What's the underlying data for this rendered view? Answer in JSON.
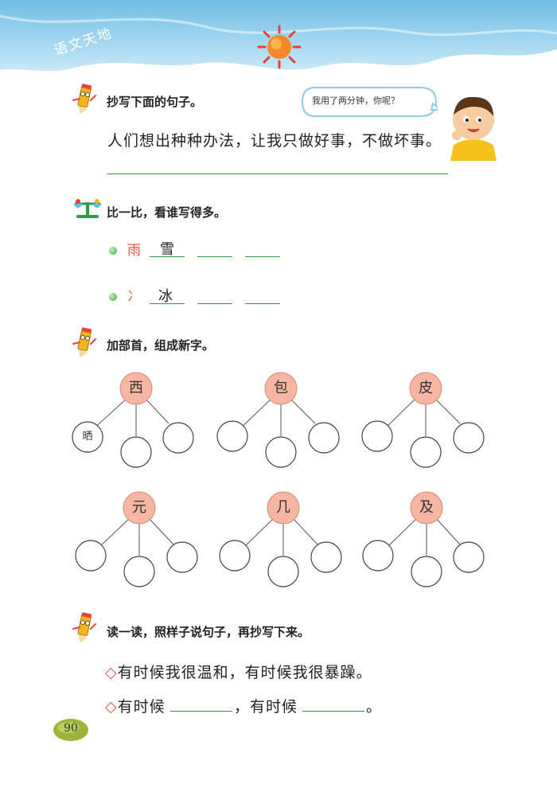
{
  "header": {
    "title": "语文天地"
  },
  "section1": {
    "title": "抄写下面的句子。",
    "sentence": "人们想出种种办法，让我只做好事，不做坏事。",
    "bubble": "我用了两分钟，你呢？"
  },
  "section2": {
    "title": "比一比，看谁写得多。",
    "rows": [
      {
        "radical": "雨",
        "example": "雪"
      },
      {
        "radical": "冫",
        "example": "冰"
      }
    ]
  },
  "section3": {
    "title": "加部首，组成新字。",
    "trees": [
      {
        "root": "西",
        "leaves": [
          "晒",
          "",
          ""
        ]
      },
      {
        "root": "包",
        "leaves": [
          "",
          "",
          ""
        ]
      },
      {
        "root": "皮",
        "leaves": [
          "",
          "",
          ""
        ]
      },
      {
        "root": "元",
        "leaves": [
          "",
          "",
          ""
        ]
      },
      {
        "root": "几",
        "leaves": [
          "",
          "",
          ""
        ]
      },
      {
        "root": "及",
        "leaves": [
          "",
          "",
          ""
        ]
      }
    ]
  },
  "section4": {
    "title": "读一读，照样子说句子，再抄写下来。",
    "example_sentence": "有时候我很温和，有时候我很暴躁。",
    "fill_prefix": "有时候",
    "fill_middle": "，有时候",
    "fill_end": "。"
  },
  "page_number": "90",
  "colors": {
    "accent_green": "#2f9a4a",
    "circle_pink": "#f6b6a2",
    "sky_blue": "#9fd3ec",
    "diamond": "#e0604a"
  }
}
